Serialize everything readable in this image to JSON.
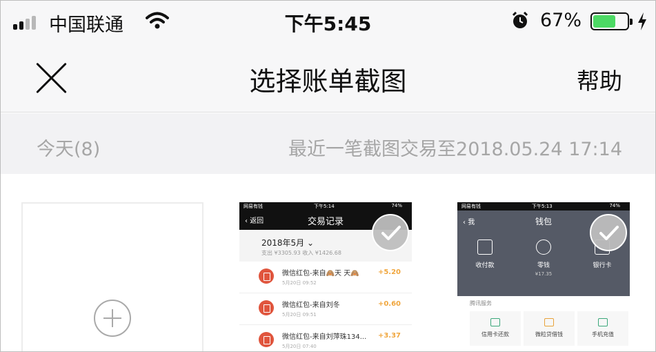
{
  "status_bar": {
    "carrier": "中国联通",
    "time": "下午5:45",
    "battery_percent": "67%",
    "battery_level": 0.67,
    "icons": [
      "signal-icon",
      "wifi-icon",
      "alarm-icon",
      "battery-icon",
      "charging-bolt-icon"
    ]
  },
  "nav": {
    "close_icon": "close-icon",
    "title": "选择账单截图",
    "help_label": "帮助"
  },
  "section": {
    "today_label": "今天(8)",
    "latest_label": "最近一笔截图交易至2018.05.24 17:14"
  },
  "add_tile": {
    "icon": "plus-circle-icon"
  },
  "screenshot_1": {
    "status_left": "网易有钱",
    "status_time": "下午5:14",
    "status_right": "74%",
    "back_label": "返回",
    "title": "交易记录",
    "month": "2018年5月",
    "summary": "支出 ¥3305.93 收入 ¥1426.68",
    "rows": [
      {
        "title": "微信红包-来自🙈天 天🙈",
        "date": "5月20日 09:52",
        "amount": "+5.20"
      },
      {
        "title": "微信红包-来自刘冬",
        "date": "5月20日 09:51",
        "amount": "+0.60"
      },
      {
        "title": "微信红包-来自刘萍珠134...",
        "date": "5月20日 07:40",
        "amount": "+3.37"
      }
    ],
    "selected": true
  },
  "screenshot_2": {
    "status_left": "网易有钱",
    "status_time": "下午5:13",
    "status_right": "74%",
    "back_label": "我",
    "title": "钱包",
    "items": [
      {
        "label": "收付款",
        "sub": ""
      },
      {
        "label": "零钱",
        "sub": "¥17.35"
      },
      {
        "label": "银行卡",
        "sub": ""
      }
    ],
    "services_label": "腾讯服务",
    "services": [
      {
        "label": "信用卡还款"
      },
      {
        "label": "微粒贷借钱"
      },
      {
        "label": "手机充值"
      }
    ],
    "selected": true
  },
  "colors": {
    "charge_green": "#4cd964",
    "amount_orange": "#f0a63d",
    "wallet_header": "#555a66",
    "muted_text": "#a6a6a6"
  }
}
